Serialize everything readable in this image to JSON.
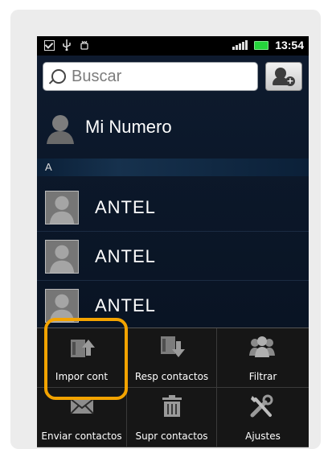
{
  "status_bar": {
    "time": "13:54"
  },
  "search": {
    "placeholder": "Buscar"
  },
  "profile": {
    "label": "Mi Numero"
  },
  "section": {
    "letter": "A"
  },
  "contacts": [
    {
      "name": "ANTEL"
    },
    {
      "name": "ANTEL"
    },
    {
      "name": "ANTEL"
    }
  ],
  "menu": {
    "items": [
      {
        "label": "Impor cont",
        "icon": "import-contacts-icon"
      },
      {
        "label": "Resp contactos",
        "icon": "backup-contacts-icon"
      },
      {
        "label": "Filtrar",
        "icon": "filter-people-icon"
      },
      {
        "label": "Enviar contactos",
        "icon": "send-contacts-icon"
      },
      {
        "label": "Supr contactos",
        "icon": "delete-contacts-icon"
      },
      {
        "label": "Ajustes",
        "icon": "settings-tools-icon"
      }
    ]
  },
  "colors": {
    "highlight": "#f3a300",
    "screen_bg": "#0e1b2f",
    "menu_bg": "#161616"
  }
}
